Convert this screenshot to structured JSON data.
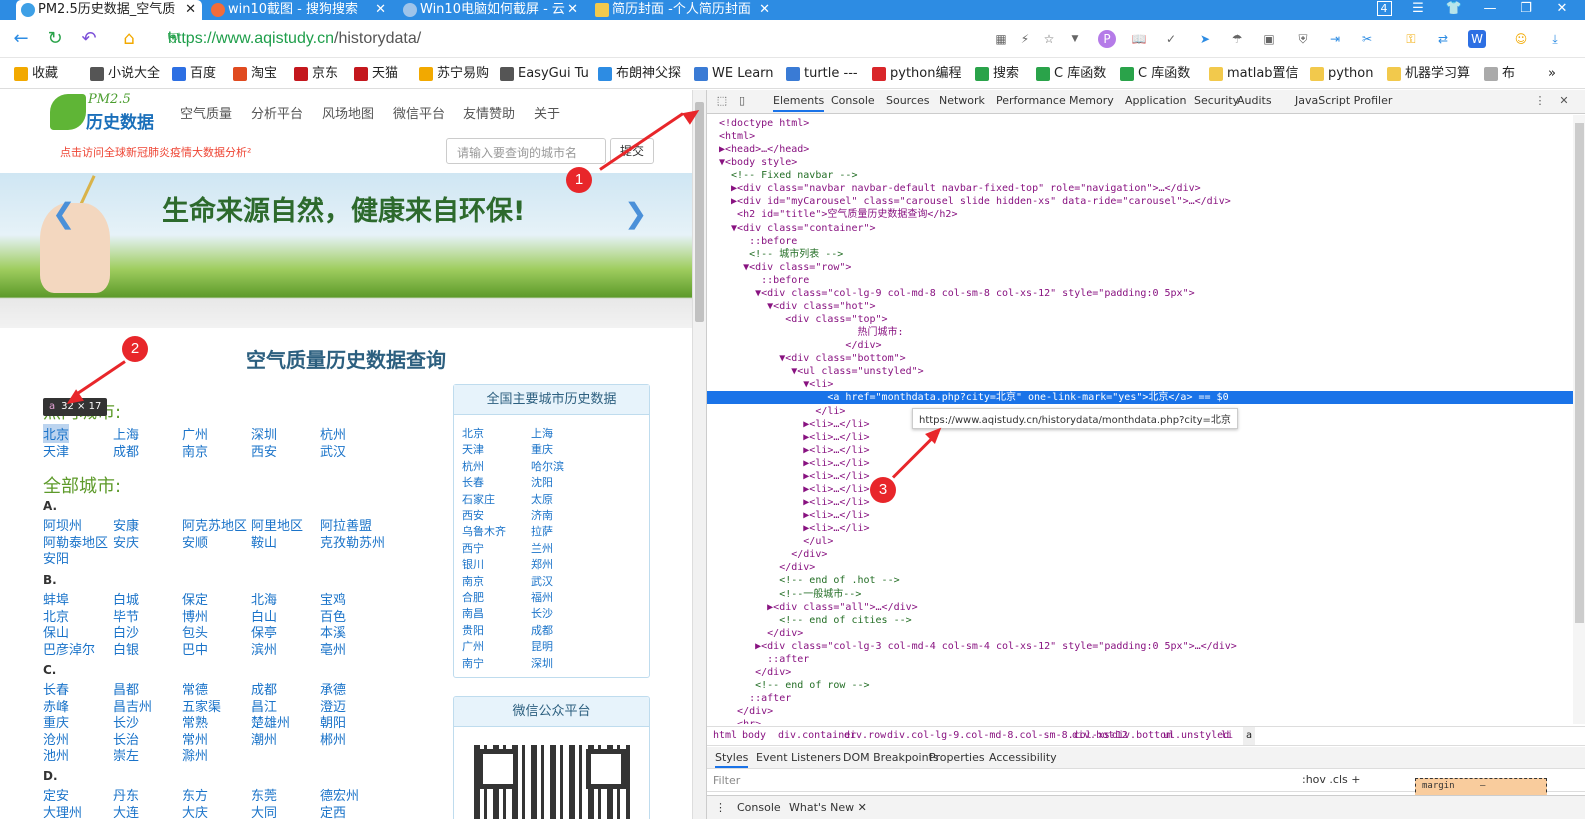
{
  "browser": {
    "tabs": [
      {
        "title": "PM2.5历史数据_空气质",
        "active": true
      },
      {
        "title": "win10截图 - 搜狗搜索",
        "active": false
      },
      {
        "title": "Win10电脑如何截屏 - 云",
        "active": false
      },
      {
        "title": "简历封面 -个人简历封面",
        "active": false
      }
    ],
    "tab_count": "4",
    "url_proto": "https://",
    "url_host": "www.aqistudy.cn",
    "url_path": "/historydata/",
    "bookmarks": [
      "收藏",
      "小说大全",
      "百度",
      "淘宝",
      "京东",
      "天猫",
      "苏宁易购",
      "EasyGui Tu",
      "布朗神父探",
      "WE Learn",
      "turtle ---",
      "python编程",
      "搜索",
      "C 库函数",
      "C 库函数",
      "matlab置信",
      "python",
      "机器学习算",
      "布"
    ],
    "overflow": "»"
  },
  "site": {
    "logo_small": "PM2.5",
    "logo_text": "历史数据",
    "nav": [
      "空气质量",
      "分析平台",
      "风场地图",
      "微信平台",
      "友情赞助",
      "关于"
    ],
    "covid_link": "点击访问全球新冠肺炎疫情大数据分析²",
    "search_placeholder": "请输入要查询的城市名",
    "search_button": "提交",
    "banner_slogan": "生命来源自然，健康来自环保!",
    "title": "空气质量历史数据查询",
    "hot_title": "热门城市:",
    "hot_cities": [
      "北京",
      "上海",
      "广州",
      "深圳",
      "杭州",
      "天津",
      "成都",
      "南京",
      "西安",
      "武汉"
    ],
    "all_title": "全部城市:",
    "groups": [
      {
        "letter": "A.",
        "cities": [
          "阿坝州",
          "安康",
          "阿克苏地区",
          "阿里地区",
          "阿拉善盟",
          "阿勒泰地区",
          "安庆",
          "安顺",
          "鞍山",
          "克孜勒苏州",
          "安阳"
        ]
      },
      {
        "letter": "B.",
        "cities": [
          "蚌埠",
          "白城",
          "保定",
          "北海",
          "宝鸡",
          "北京",
          "毕节",
          "博州",
          "白山",
          "百色",
          "保山",
          "白沙",
          "包头",
          "保亭",
          "本溪",
          "巴彦淖尔",
          "白银",
          "巴中",
          "滨州",
          "亳州"
        ]
      },
      {
        "letter": "C.",
        "cities": [
          "长春",
          "昌都",
          "常德",
          "成都",
          "承德",
          "赤峰",
          "昌吉州",
          "五家渠",
          "昌江",
          "澄迈",
          "重庆",
          "长沙",
          "常熟",
          "楚雄州",
          "朝阳",
          "沧州",
          "长治",
          "常州",
          "潮州",
          "郴州",
          "池州",
          "崇左",
          "滁州"
        ]
      },
      {
        "letter": "D.",
        "cities": [
          "定安",
          "丹东",
          "东方",
          "东莞",
          "德宏州",
          "大理州",
          "大连",
          "大庆",
          "大同",
          "定西"
        ]
      }
    ],
    "panel_title": "全国主要城市历史数据",
    "panel_cities": [
      "北京",
      "上海",
      "天津",
      "重庆",
      "杭州",
      "哈尔滨",
      "长春",
      "沈阳",
      "石家庄",
      "太原",
      "西安",
      "济南",
      "乌鲁木齐",
      "拉萨",
      "西宁",
      "兰州",
      "银川",
      "郑州",
      "南京",
      "武汉",
      "合肥",
      "福州",
      "南昌",
      "长沙",
      "贵阳",
      "成都",
      "广州",
      "昆明",
      "南宁",
      "深圳"
    ],
    "wechat_title": "微信公众平台",
    "size_tip_tag": "a",
    "size_tip_dims": "32 × 17"
  },
  "devtools": {
    "tabs": [
      "Elements",
      "Console",
      "Sources",
      "Network",
      "Performance",
      "Memory",
      "Application",
      "Security",
      "Audits",
      "JavaScript Profiler"
    ],
    "lines": [
      "<!doctype html>",
      "<html>",
      "▶<head>…</head>",
      "▼<body style>",
      "  <!-- Fixed navbar -->",
      "  ▶<div class=\"navbar navbar-default navbar-fixed-top\" role=\"navigation\">…</div>",
      "  ▶<div id=\"myCarousel\" class=\"carousel slide hidden-xs\" data-ride=\"carousel\">…</div>",
      "   <h2 id=\"title\">空气质量历史数据查询</h2>",
      "  ▼<div class=\"container\">",
      "     ::before",
      "     <!-- 城市列表 -->",
      "    ▼<div class=\"row\">",
      "       ::before",
      "      ▼<div class=\"col-lg-9 col-md-8 col-sm-8 col-xs-12\" style=\"padding:0 5px\">",
      "        ▼<div class=\"hot\">",
      "           <div class=\"top\">",
      "                       热门城市:",
      "                     </div>",
      "          ▼<div class=\"bottom\">",
      "            ▼<ul class=\"unstyled\">",
      "              ▼<li>",
      "                  <a href=\"monthdata.php?city=北京\" one-link-mark=\"yes\">北京</a> == $0",
      "                </li>",
      "              ▶<li>…</li>",
      "              ▶<li>…</li>",
      "              ▶<li>…</li>",
      "              ▶<li>…</li>",
      "              ▶<li>…</li>",
      "              ▶<li>…</li>",
      "              ▶<li>…</li>",
      "              ▶<li>…</li>",
      "              ▶<li>…</li>",
      "              </ul>",
      "            </div>",
      "          </div>",
      "          <!-- end of .hot -->",
      "          <!--一般城市-->",
      "        ▶<div class=\"all\">…</div>",
      "          <!-- end of cities -->",
      "        </div>",
      "      ▶<div class=\"col-lg-3 col-md-4 col-sm-4 col-xs-12\" style=\"padding:0 5px\">…</div>",
      "        ::after",
      "      </div>",
      "      <!-- end of row -->",
      "     ::after",
      "   </div>",
      "   <hr>"
    ],
    "selected_line": 21,
    "hover_url": "https://www.aqistudy.cn/historydata/monthdata.php?city=北京",
    "crumbs": [
      "html",
      "body",
      "div.container",
      "div.row",
      "div.col-lg-9.col-md-8.col-sm-8.col-xs-12",
      "div.hot",
      "div.bottom",
      "ul.unstyled",
      "li",
      "a"
    ],
    "subtabs": [
      "Styles",
      "Event Listeners",
      "DOM Breakpoints",
      "Properties",
      "Accessibility"
    ],
    "filter_placeholder": "Filter",
    "filter_right": ":hov  .cls  +",
    "margin_label": "margin",
    "margin_value": "–",
    "console_tabs": [
      "Console",
      "What's New ✕"
    ]
  },
  "annotations": [
    "1",
    "2",
    "3"
  ]
}
